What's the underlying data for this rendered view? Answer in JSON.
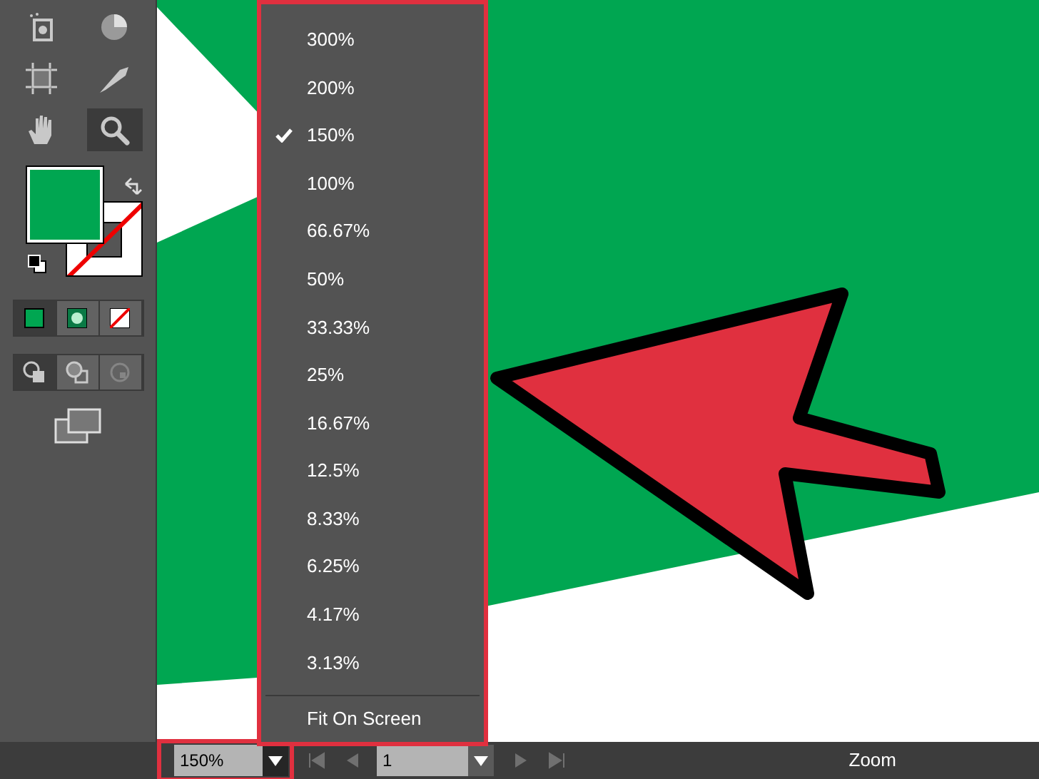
{
  "toolbar": {
    "tools": [
      {
        "kind": "sprayer",
        "selected": false
      },
      {
        "kind": "graph",
        "selected": false
      },
      {
        "kind": "artboard",
        "selected": false
      },
      {
        "kind": "slice",
        "selected": false
      },
      {
        "kind": "hand",
        "selected": false
      },
      {
        "kind": "zoom",
        "selected": true
      }
    ],
    "modes": [
      {
        "kind": "color",
        "selected": true
      },
      {
        "kind": "gradient",
        "selected": false
      },
      {
        "kind": "none",
        "selected": false
      }
    ],
    "draw_modes": [
      {
        "kind": "normal",
        "selected": true
      },
      {
        "kind": "behind",
        "selected": false
      },
      {
        "kind": "inside",
        "selected": false,
        "disabled": true
      }
    ]
  },
  "zoom_menu": {
    "items": [
      {
        "label": "300%",
        "selected": false
      },
      {
        "label": "200%",
        "selected": false
      },
      {
        "label": "150%",
        "selected": true
      },
      {
        "label": "100%",
        "selected": false
      },
      {
        "label": "66.67%",
        "selected": false
      },
      {
        "label": "50%",
        "selected": false
      },
      {
        "label": "33.33%",
        "selected": false
      },
      {
        "label": "25%",
        "selected": false
      },
      {
        "label": "16.67%",
        "selected": false
      },
      {
        "label": "12.5%",
        "selected": false
      },
      {
        "label": "8.33%",
        "selected": false
      },
      {
        "label": "6.25%",
        "selected": false
      },
      {
        "label": "4.17%",
        "selected": false
      },
      {
        "label": "3.13%",
        "selected": false
      }
    ],
    "fit": "Fit On Screen"
  },
  "status_bar": {
    "zoom_value": "150%",
    "page": "1",
    "label": "Zoom"
  }
}
